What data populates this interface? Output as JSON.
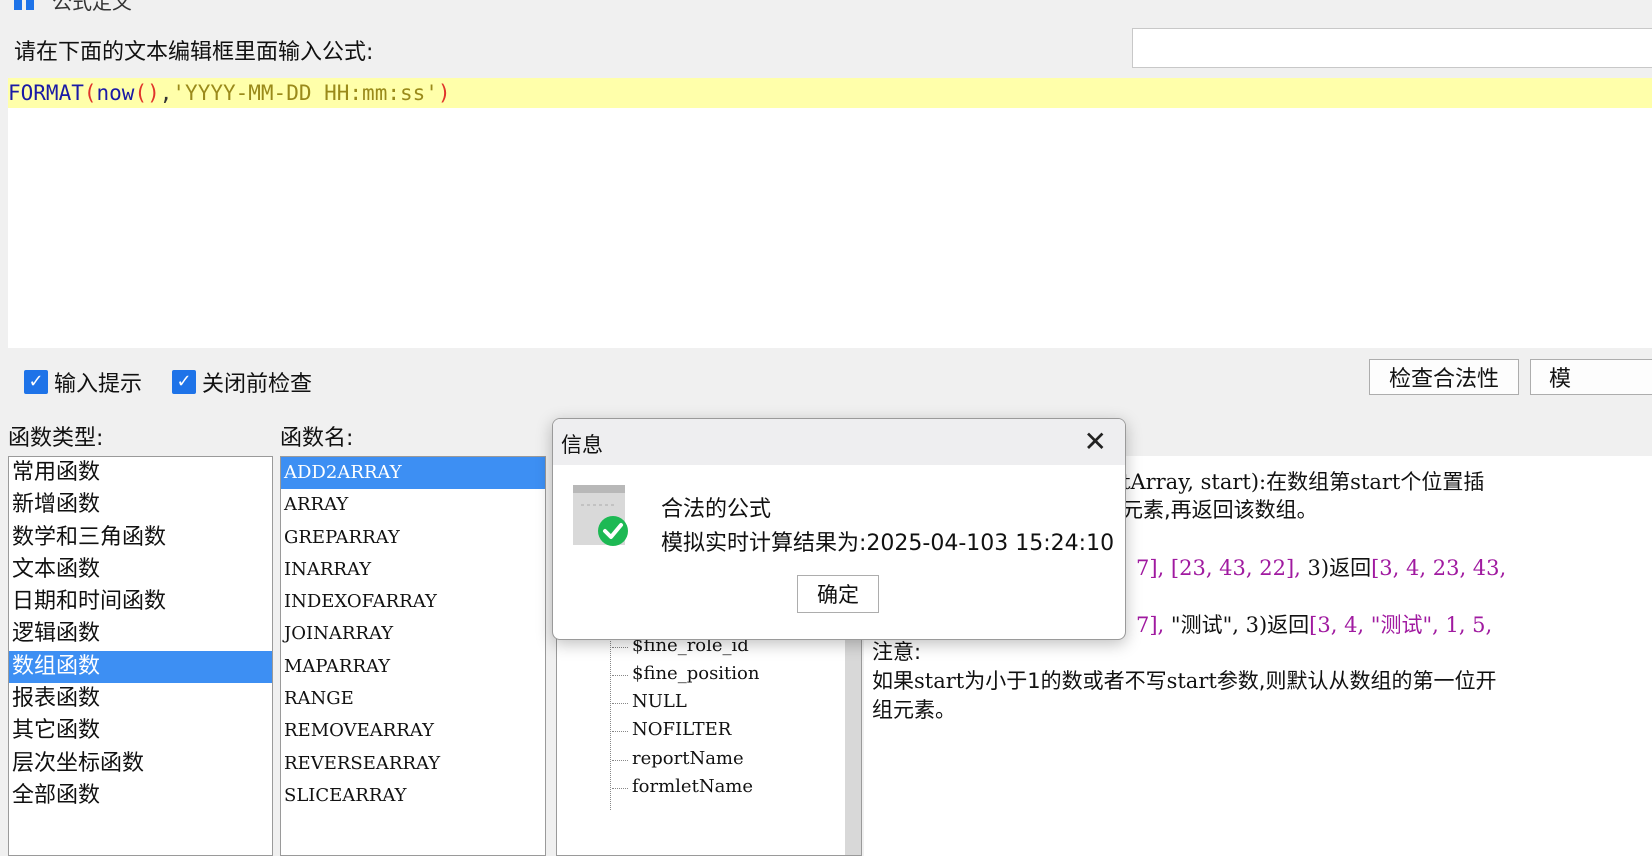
{
  "window": {
    "title": "公式定义"
  },
  "editor": {
    "prompt": "请在下面的文本编辑框里面输入公式:",
    "formula": {
      "fn": "FORMAT",
      "open": "(",
      "inner_fn": "now",
      "inner_parens": "()",
      "comma": ",",
      "str": "'YYYY-MM-DD HH:mm:ss'",
      "close": ")"
    },
    "search_value": ""
  },
  "options": {
    "input_hint": "输入提示",
    "check_before_close": "关闭前检查"
  },
  "buttons": {
    "check_validity": "检查合法性",
    "simulate": "模"
  },
  "function_types": {
    "label": "函数类型:",
    "items": [
      "常用函数",
      "新增函数",
      "数学和三角函数",
      "文本函数",
      "日期和时间函数",
      "逻辑函数",
      "数组函数",
      "报表函数",
      "其它函数",
      "层次坐标函数",
      "全部函数"
    ],
    "selected": "数组函数"
  },
  "function_names": {
    "label": "函数名:",
    "items": [
      "ADD2ARRAY",
      "ARRAY",
      "GREPARRAY",
      "INARRAY",
      "INDEXOFARRAY",
      "JOINARRAY",
      "MAPARRAY",
      "RANGE",
      "REMOVEARRAY",
      "REVERSEARRAY",
      "SLICEARRAY"
    ],
    "selected": "ADD2ARRAY"
  },
  "variables": [
    "$fine_role_id",
    "$fine_position",
    "NULL",
    "NOFILTER",
    "reportName",
    "formletName"
  ],
  "description": {
    "line1a": "tArray, start):在数组第",
    "line1b": "start",
    "line1c": "个位置插",
    "line2": "元素,再返回该数组。",
    "line3a": "7],",
    "line3b": "[23, 43, 22],",
    "line3c": "3)返回",
    "line3d": "[3, 4, 23, 43,",
    "line4a": "7],",
    "line4b": "\"测试\",",
    "line4c": "3)返回",
    "line4d": "[3, 4, \"测试\", 1, 5,",
    "note": "注意:",
    "line5a": "如果",
    "line5b": "start",
    "line5c": "为小于1的数或者不写",
    "line5d": "start",
    "line5e": "参数,则默认从数组的第一位开",
    "line6": "组元素。"
  },
  "dialog": {
    "title": "信息",
    "message1": "合法的公式",
    "message2": "模拟实时计算结果为:2025-04-103 15:24:10",
    "ok": "确定"
  },
  "colors": {
    "selection": "#3d8ff3",
    "checkbox": "#1e73e8",
    "editor_line": "#ffffaa",
    "success": "#1db954"
  }
}
